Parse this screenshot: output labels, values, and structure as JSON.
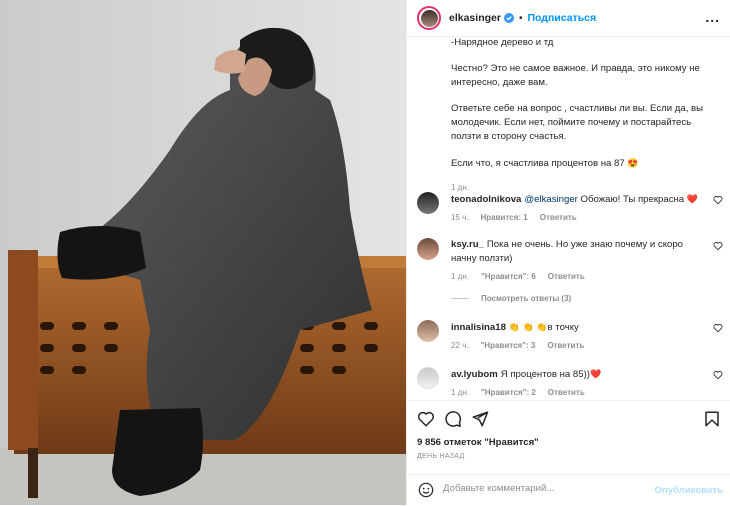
{
  "post": {
    "username": "elkasinger",
    "follow_label": "Подписаться",
    "dot": "•",
    "more": "...",
    "caption_lines": [
      "-Нарядное дерево и тд",
      "Честно? Это не самое важное. И правда, это никому не интересно, даже вам.",
      "Ответьте себе на вопрос , счастливы ли вы. Если да, вы молодечик. Если нет, поймите почему и постарайтесь ползти в сторону счастья.",
      "Если что, я счастлива процентов на 87"
    ],
    "caption_emoji": "😍",
    "caption_time": "1 дн."
  },
  "comments": [
    {
      "user": "teonadolnikova",
      "mention": "@elkasinger",
      "text": " Обожаю! Ты прекрасна ",
      "emoji": "❤️",
      "time": "15 ч.",
      "likes": "Нравится: 1",
      "reply": "Ответить"
    },
    {
      "user": "ksy.ru_",
      "text": "Пока не очень. Но уже знаю почему и скоро начну ползти)",
      "time": "1 дн.",
      "likes": "\"Нравится\": 6",
      "reply": "Ответить"
    },
    {
      "user": "innalisina18",
      "emoji": "👏 👏 👏",
      "text": "в точку",
      "time": "22 ч.",
      "likes": "\"Нравится\": 3",
      "reply": "Ответить"
    },
    {
      "user": "av.lyubom",
      "text": "Я процентов на 85))",
      "emoji": "❤️",
      "time": "1 дн.",
      "likes": "\"Нравится\": 2",
      "reply": "Ответить"
    }
  ],
  "replies_label": "Посмотреть ответы (3)",
  "likes_count": "9 856 отметок \"Нравится\"",
  "date": "ДЕНЬ НАЗАД",
  "add_comment": {
    "placeholder": "Добавьте комментарий...",
    "publish": "Опубликовать"
  },
  "icons": {
    "like": "heart-icon",
    "comment": "comment-icon",
    "share": "share-icon",
    "save": "bookmark-icon",
    "emoji": "emoji-icon"
  },
  "colors": {
    "link": "#0095f6",
    "verified": "#3897f0",
    "heart": "#ed4956"
  }
}
